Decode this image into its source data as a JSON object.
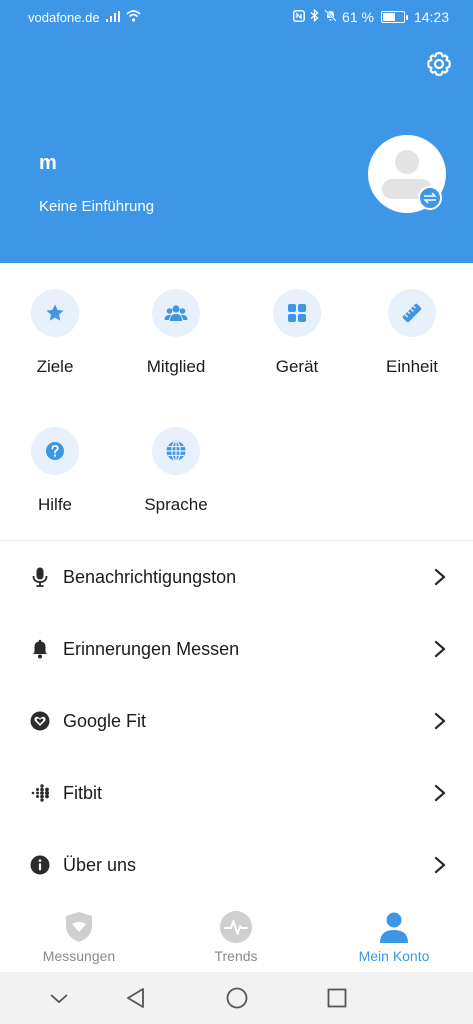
{
  "status_bar": {
    "carrier": "vodafone.de",
    "battery": "61 %",
    "time": "14:23",
    "battery_level": 0.61
  },
  "header": {
    "username": "m",
    "subtitle": "Keine Einführung",
    "settings_icon": "gear-icon",
    "avatar_icon": "person-icon",
    "swap_icon": "swap-icon"
  },
  "grid": [
    {
      "label": "Ziele",
      "icon": "star-icon"
    },
    {
      "label": "Mitglied",
      "icon": "group-icon"
    },
    {
      "label": "Gerät",
      "icon": "grid-icon"
    },
    {
      "label": "Einheit",
      "icon": "ruler-icon"
    },
    {
      "label": "Hilfe",
      "icon": "help-icon"
    },
    {
      "label": "Sprache",
      "icon": "globe-icon"
    }
  ],
  "list": [
    {
      "label": "Benachrichtigungston",
      "icon": "microphone-icon"
    },
    {
      "label": "Erinnerungen Messen",
      "icon": "bell-icon"
    },
    {
      "label": "Google Fit",
      "icon": "heart-icon"
    },
    {
      "label": "Fitbit",
      "icon": "fitbit-icon"
    },
    {
      "label": "Über uns",
      "icon": "info-icon"
    }
  ],
  "bottom_nav": [
    {
      "label": "Messungen",
      "icon": "shield-icon",
      "active": false
    },
    {
      "label": "Trends",
      "icon": "pulse-icon",
      "active": false
    },
    {
      "label": "Mein Konto",
      "icon": "person-icon",
      "active": true
    }
  ],
  "colors": {
    "accent": "#3d96e6",
    "icon_bg": "#e8f1fb",
    "text": "#1c1c1e",
    "muted": "#8a8a8a"
  }
}
